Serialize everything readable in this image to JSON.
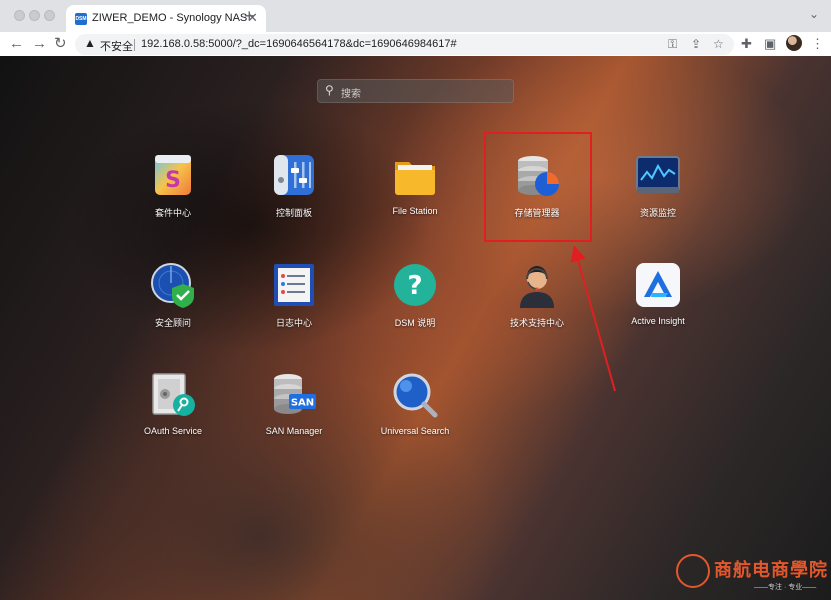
{
  "browser": {
    "tab_title": "ZIWER_DEMO - Synology NAS",
    "favicon_text": "DSM",
    "new_tab_symbol": "+",
    "security_label": "不安全",
    "url": "192.168.0.58:5000/?_dc=1690646564178&dc=1690646984617#"
  },
  "desktop": {
    "search_placeholder": "搜索",
    "apps": [
      {
        "label": "套件中心",
        "icon": "package-center-icon"
      },
      {
        "label": "控制面板",
        "icon": "control-panel-icon"
      },
      {
        "label": "File Station",
        "icon": "file-station-icon"
      },
      {
        "label": "存储管理器",
        "icon": "storage-manager-icon"
      },
      {
        "label": "资源监控",
        "icon": "resource-monitor-icon"
      },
      {
        "label": "安全顾问",
        "icon": "security-advisor-icon"
      },
      {
        "label": "日志中心",
        "icon": "log-center-icon"
      },
      {
        "label": "DSM 说明",
        "icon": "dsm-help-icon"
      },
      {
        "label": "技术支持中心",
        "icon": "support-center-icon"
      },
      {
        "label": "Active Insight",
        "icon": "active-insight-icon"
      },
      {
        "label": "OAuth Service",
        "icon": "oauth-service-icon"
      },
      {
        "label": "SAN Manager",
        "icon": "san-manager-icon"
      },
      {
        "label": "Universal Search",
        "icon": "universal-search-icon"
      }
    ],
    "dsm_help_glyph": "?",
    "san_badge": "SAN",
    "package_center_glyph": "S"
  },
  "watermark": {
    "title": "商航电商學院",
    "subtitle": "——专注 · 专业——"
  },
  "colors": {
    "highlight": "#e02020",
    "watermark": "#e2572b"
  }
}
